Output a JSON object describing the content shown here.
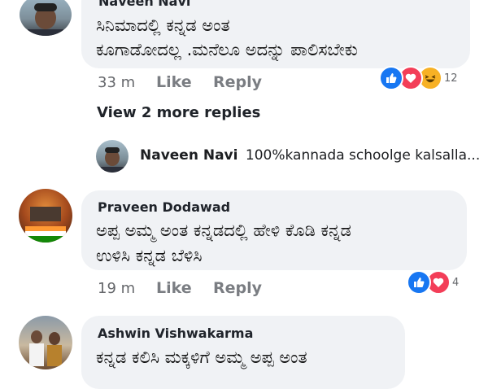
{
  "comment1": {
    "author": "Naveen Navi",
    "line1": "ಸಿನಿಮಾದಲ್ಲಿ ಕನ್ನಡ ಅಂತ",
    "line2": "ಕೂಗಾಡೋದಲ್ಲ .ಮನೆಲೂ ಅದನ್ನು ಪಾಲಿಸಬೇಕು",
    "time": "33 m",
    "like": "Like",
    "reply": "Reply",
    "reaction_count": "12"
  },
  "view_more": "View 2 more replies",
  "reply_preview": {
    "author": "Naveen Navi",
    "text": "100%kannada schoolge kalsalla..."
  },
  "comment2": {
    "author": "Praveen Dodawad",
    "line1": "ಅಪ್ಪ ಅಮ್ಮ ಅಂತ ಕನ್ನಡದಲ್ಲಿ ಹೇಳಿ ಕೊಡಿ ಕನ್ನಡ",
    "line2": "ಉಳಿಸಿ ಕನ್ನಡ ಬೆಳಿಸಿ",
    "time": "19 m",
    "like": "Like",
    "reply": "Reply",
    "reaction_count": "4"
  },
  "comment3": {
    "author": "Ashwin Vishwakarma",
    "line1": "ಕನ್ನಡ ಕಲಿಸಿ ಮಕ್ಕಳಿಗೆ ಅಮ್ಮ ಅಪ್ಪ ಅಂತ"
  },
  "colors": {
    "like_blue": "#1877f2",
    "love_red": "#f33e58",
    "haha_yellow": "#f7b125",
    "bubble_bg": "#f0f2f5"
  },
  "icons": [
    "like-icon",
    "love-icon",
    "haha-icon"
  ]
}
